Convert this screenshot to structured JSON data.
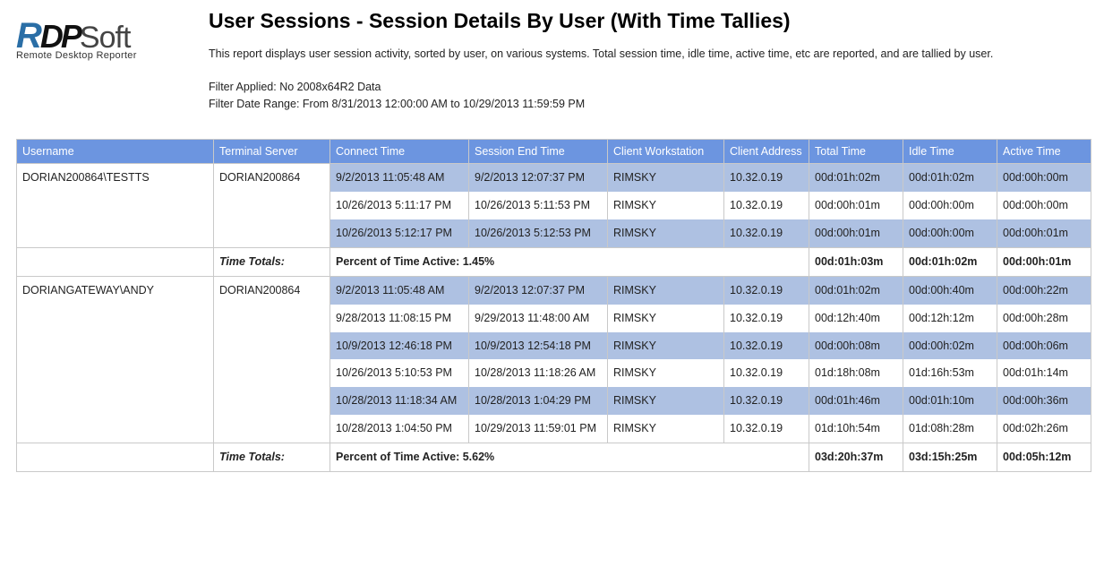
{
  "logo": {
    "brand_r": "R",
    "brand_dp": "DP",
    "brand_soft": "Soft",
    "tagline": "Remote Desktop Reporter"
  },
  "title": "User Sessions - Session Details By User (With Time Tallies)",
  "description": "This report displays user session activity, sorted by user, on various systems.  Total session time, idle time, active time, etc are reported, and are tallied by user.",
  "filter_applied": "Filter Applied: No 2008x64R2 Data",
  "filter_range": "Filter Date Range: From 8/31/2013 12:00:00 AM to 10/29/2013 11:59:59 PM",
  "columns": {
    "username": "Username",
    "server": "Terminal Server",
    "connect": "Connect Time",
    "end": "Session End Time",
    "workstation": "Client Workstation",
    "address": "Client Address",
    "total": "Total Time",
    "idle": "Idle Time",
    "active": "Active Time"
  },
  "totals_label": "Time Totals:",
  "groups": [
    {
      "username": "DORIAN200864\\TESTTS",
      "server": "DORIAN200864",
      "rows": [
        {
          "connect": "9/2/2013 11:05:48 AM",
          "end": "9/2/2013 12:07:37 PM",
          "wks": "RIMSKY",
          "addr": "10.32.0.19",
          "total": "00d:01h:02m",
          "idle": "00d:01h:02m",
          "active": "00d:00h:00m"
        },
        {
          "connect": "10/26/2013 5:11:17 PM",
          "end": "10/26/2013 5:11:53 PM",
          "wks": "RIMSKY",
          "addr": "10.32.0.19",
          "total": "00d:00h:01m",
          "idle": "00d:00h:00m",
          "active": "00d:00h:00m"
        },
        {
          "connect": "10/26/2013 5:12:17 PM",
          "end": "10/26/2013 5:12:53 PM",
          "wks": "RIMSKY",
          "addr": "10.32.0.19",
          "total": "00d:00h:01m",
          "idle": "00d:00h:00m",
          "active": "00d:00h:01m"
        }
      ],
      "totals": {
        "percent": "Percent of Time Active: 1.45%",
        "total": "00d:01h:03m",
        "idle": "00d:01h:02m",
        "active": "00d:00h:01m"
      }
    },
    {
      "username": "DORIANGATEWAY\\ANDY",
      "server": "DORIAN200864",
      "rows": [
        {
          "connect": "9/2/2013 11:05:48 AM",
          "end": "9/2/2013 12:07:37 PM",
          "wks": "RIMSKY",
          "addr": "10.32.0.19",
          "total": "00d:01h:02m",
          "idle": "00d:00h:40m",
          "active": "00d:00h:22m"
        },
        {
          "connect": "9/28/2013 11:08:15 PM",
          "end": "9/29/2013 11:48:00 AM",
          "wks": "RIMSKY",
          "addr": "10.32.0.19",
          "total": "00d:12h:40m",
          "idle": "00d:12h:12m",
          "active": "00d:00h:28m"
        },
        {
          "connect": "10/9/2013 12:46:18 PM",
          "end": "10/9/2013 12:54:18 PM",
          "wks": "RIMSKY",
          "addr": "10.32.0.19",
          "total": "00d:00h:08m",
          "idle": "00d:00h:02m",
          "active": "00d:00h:06m"
        },
        {
          "connect": "10/26/2013 5:10:53 PM",
          "end": "10/28/2013 11:18:26 AM",
          "wks": "RIMSKY",
          "addr": "10.32.0.19",
          "total": "01d:18h:08m",
          "idle": "01d:16h:53m",
          "active": "00d:01h:14m"
        },
        {
          "connect": "10/28/2013 11:18:34 AM",
          "end": "10/28/2013 1:04:29 PM",
          "wks": "RIMSKY",
          "addr": "10.32.0.19",
          "total": "00d:01h:46m",
          "idle": "00d:01h:10m",
          "active": "00d:00h:36m"
        },
        {
          "connect": "10/28/2013 1:04:50 PM",
          "end": "10/29/2013 11:59:01 PM",
          "wks": "RIMSKY",
          "addr": "10.32.0.19",
          "total": "01d:10h:54m",
          "idle": "01d:08h:28m",
          "active": "00d:02h:26m"
        }
      ],
      "totals": {
        "percent": "Percent of Time Active: 5.62%",
        "total": "03d:20h:37m",
        "idle": "03d:15h:25m",
        "active": "00d:05h:12m"
      }
    }
  ]
}
